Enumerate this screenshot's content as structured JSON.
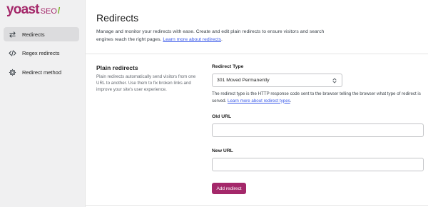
{
  "logo": {
    "word": "yoast",
    "suffix": "SEO",
    "slash": "/"
  },
  "sidebar": {
    "items": [
      {
        "label": "Redirects",
        "icon": "arrows-left-right-icon",
        "active": true
      },
      {
        "label": "Regex redirects",
        "icon": "code-icon",
        "active": false
      },
      {
        "label": "Redirect method",
        "icon": "gear-icon",
        "active": false
      }
    ]
  },
  "main": {
    "title": "Redirects",
    "description": "Manage and monitor your redirects with ease. Create and edit plain redirects to ensure visitors and search engines reach the right pages.",
    "description_link": "Learn more about redirects",
    "section": {
      "title": "Plain redirects",
      "description": "Plain redirects automatically send visitors from one URL to another. Use them to fix broken links and improve your site's user experience."
    },
    "form": {
      "redirect_type_label": "Redirect Type",
      "redirect_type_value": "301 Moved Permanently",
      "help_text": "The redirect type is the HTTP response code sent to the browser telling the browser what type of redirect is served.",
      "help_link": "Learn more about redirect types",
      "old_url_label": "Old URL",
      "old_url_value": "",
      "new_url_label": "New URL",
      "new_url_value": "",
      "submit_label": "Add redirect"
    }
  },
  "colors": {
    "brand": "#a4286a",
    "accent_green": "#77b227",
    "link": "#3858e9"
  }
}
